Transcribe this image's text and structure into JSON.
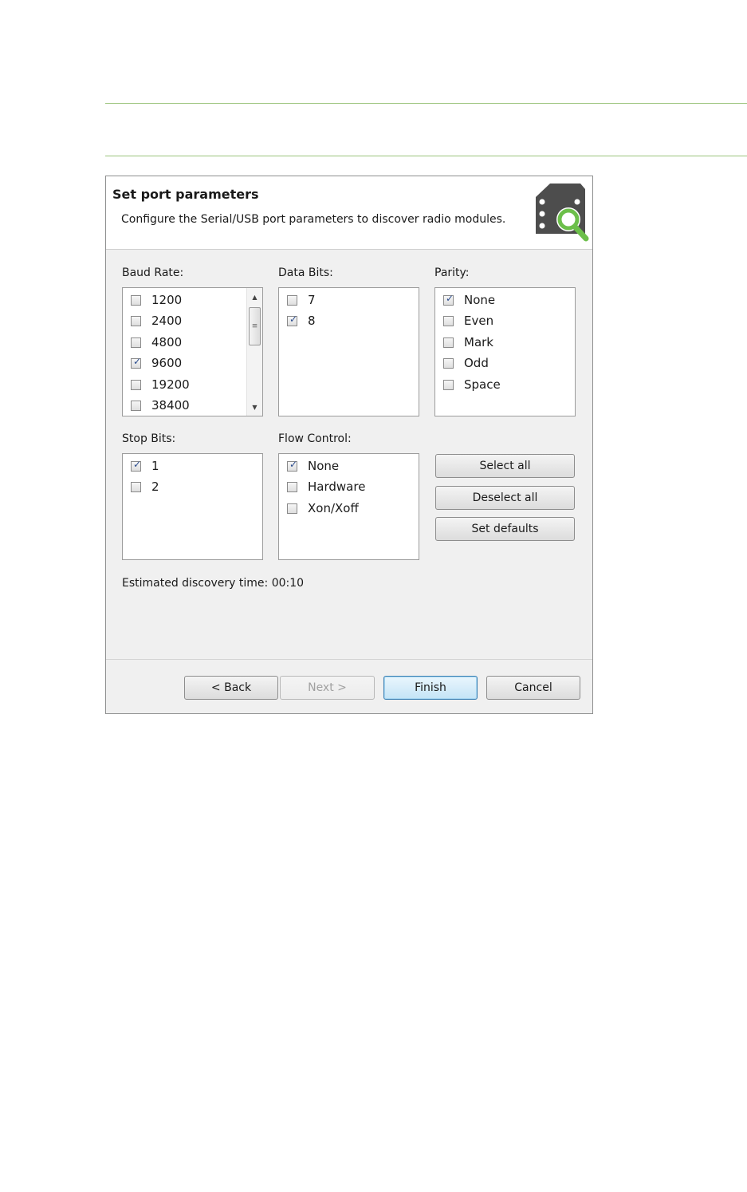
{
  "header": {
    "title": "Set port parameters",
    "description": "Configure the Serial/USB port parameters to discover radio modules."
  },
  "baud_rate": {
    "label": "Baud Rate:",
    "items": [
      {
        "label": "1200",
        "checked": false
      },
      {
        "label": "2400",
        "checked": false
      },
      {
        "label": "4800",
        "checked": false
      },
      {
        "label": "9600",
        "checked": true
      },
      {
        "label": "19200",
        "checked": false
      },
      {
        "label": "38400",
        "checked": false
      }
    ]
  },
  "data_bits": {
    "label": "Data Bits:",
    "items": [
      {
        "label": "7",
        "checked": false
      },
      {
        "label": "8",
        "checked": true
      }
    ]
  },
  "parity": {
    "label": "Parity:",
    "items": [
      {
        "label": "None",
        "checked": true
      },
      {
        "label": "Even",
        "checked": false
      },
      {
        "label": "Mark",
        "checked": false
      },
      {
        "label": "Odd",
        "checked": false
      },
      {
        "label": "Space",
        "checked": false
      }
    ]
  },
  "stop_bits": {
    "label": "Stop Bits:",
    "items": [
      {
        "label": "1",
        "checked": true
      },
      {
        "label": "2",
        "checked": false
      }
    ]
  },
  "flow_control": {
    "label": "Flow Control:",
    "items": [
      {
        "label": "None",
        "checked": true
      },
      {
        "label": "Hardware",
        "checked": false
      },
      {
        "label": "Xon/Xoff",
        "checked": false
      }
    ]
  },
  "actions": {
    "select_all": "Select all",
    "deselect_all": "Deselect all",
    "set_defaults": "Set defaults"
  },
  "estimate": "Estimated discovery time: 00:10",
  "footer": {
    "back": "< Back",
    "next": "Next >",
    "finish": "Finish",
    "cancel": "Cancel"
  },
  "colors": {
    "accent_rule": "#9bc47c",
    "icon_dark": "#4d4d4d",
    "icon_green": "#6cbf4a",
    "check": "#2c4d8e"
  },
  "icons": {
    "header": "radio-module-search-icon",
    "check": "checkmark-icon",
    "scroll_up": "triangle-up-icon",
    "scroll_down": "triangle-down-icon"
  }
}
